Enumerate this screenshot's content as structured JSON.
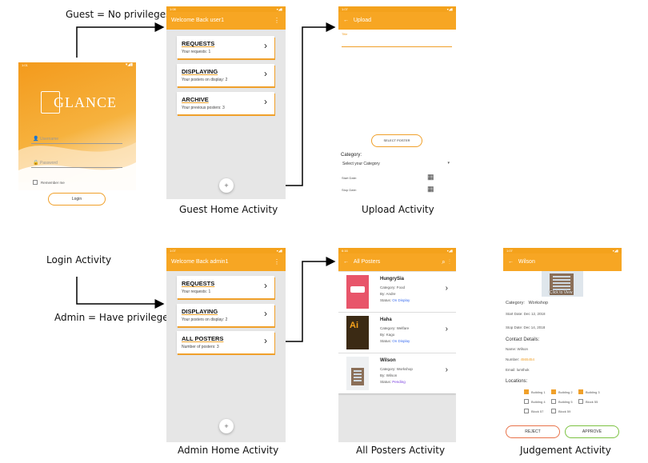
{
  "labels": {
    "guest_note": "Guest = No privileges",
    "login_activity": "Login Activity",
    "admin_note": "Admin = Have privileges",
    "guest_home": "Guest Home Activity",
    "upload": "Upload Activity",
    "admin_home": "Admin Home Activity",
    "all_posters": "All Posters Activity",
    "judgement": "Judgement Activity"
  },
  "login": {
    "time": "1:01",
    "brand": "GLANCE",
    "username_placeholder": "Username",
    "password_placeholder": "Password",
    "remember": "Remember me",
    "login_button": "Login"
  },
  "guest_home": {
    "time": "1:08",
    "title": "Welcome Back user1",
    "cards": [
      {
        "title": "REQUESTS",
        "sub": "Your requests: 1"
      },
      {
        "title": "DISPLAYING",
        "sub": "Your posters on display: 2"
      },
      {
        "title": "ARCHIVE",
        "sub": "Your previous posters: 3"
      }
    ],
    "fab": "+"
  },
  "upload": {
    "time": "1:07",
    "title": "Upload",
    "title_hint": "Title",
    "select_poster": "SELECT POSTER",
    "category_label": "Category:",
    "category_value": "Select your Category",
    "start_date": "Start Date:",
    "stop_date": "Stop Date:"
  },
  "admin_home": {
    "time": "1:07",
    "title": "Welcome Back admin1",
    "cards": [
      {
        "title": "REQUESTS",
        "sub": "Your requests: 1"
      },
      {
        "title": "DISPLAYING",
        "sub": "Your posters on display: 2"
      },
      {
        "title": "ALL POSTERS",
        "sub": "Number of posters: 3"
      }
    ],
    "fab": "+"
  },
  "all_posters": {
    "time": "6:16",
    "title": "All Posters",
    "items": [
      {
        "name": "HungrySia",
        "category": "Category: Food",
        "by": "By: Andre",
        "status_label": "Status:",
        "status": "On Display",
        "status_color": "#3a6df0"
      },
      {
        "name": "Haha",
        "category": "Category: Welfare",
        "by": "By: Kago",
        "status_label": "Status:",
        "status": "On Display",
        "status_color": "#3a6df0"
      },
      {
        "name": "Wilson",
        "category": "Category: Workshop",
        "by": "By: Wilson",
        "status_label": "Status:",
        "status": "Pending",
        "status_color": "#7a3fe0"
      }
    ]
  },
  "judgement": {
    "time": "1:07",
    "title": "Wilson",
    "click_view": "Click to View",
    "category_label": "Category:",
    "category_value": "Workshop",
    "start_date": "Start Date: Dec 12, 2018",
    "stop_date": "Stop Date: Dec 14, 2018",
    "contact_heading": "Contact Details:",
    "name": "Name: Wilson",
    "number_label": "Number:",
    "number_value": "4565454",
    "email": "Email: lumthok",
    "locations_heading": "Locations:",
    "locations": [
      {
        "name": "Building 1",
        "checked": true
      },
      {
        "name": "Building 2",
        "checked": true
      },
      {
        "name": "Building 3",
        "checked": true
      },
      {
        "name": "Building 4",
        "checked": false
      },
      {
        "name": "Building 5",
        "checked": false
      },
      {
        "name": "Block 55",
        "checked": false
      },
      {
        "name": "Block 57",
        "checked": false
      },
      {
        "name": "Block 59",
        "checked": false
      }
    ],
    "reject": "REJECT",
    "approve": "APPROVE"
  },
  "colors": {
    "accent": "#f7a623",
    "approve": "#7cc242",
    "reject": "#e8734a"
  }
}
